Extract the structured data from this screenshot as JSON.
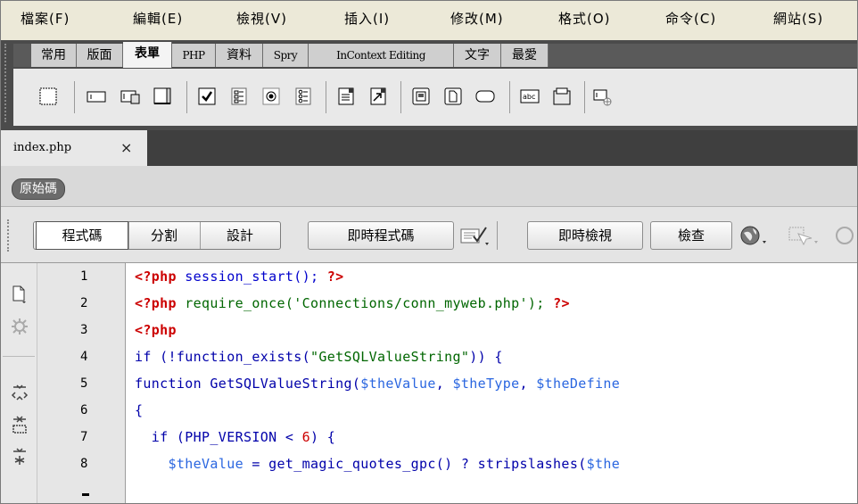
{
  "menubar": {
    "items": [
      "檔案(F)",
      "編輯(E)",
      "檢視(V)",
      "插入(I)",
      "修改(M)",
      "格式(O)",
      "命令(C)",
      "網站(S)"
    ]
  },
  "insert_panel": {
    "tabs": [
      "常用",
      "版面",
      "表單",
      "PHP",
      "資料",
      "Spry",
      "InContext Editing",
      "文字",
      "最愛"
    ],
    "active_tab": "表單",
    "icons": [
      "form-icon",
      "text-field-icon",
      "hidden-field-icon",
      "textarea-icon",
      "checkbox-icon",
      "checkbox-group-icon",
      "radio-button-icon",
      "radio-group-icon",
      "list-menu-icon",
      "jump-menu-icon",
      "image-field-icon",
      "file-field-icon",
      "button-icon",
      "label-icon",
      "fieldset-icon",
      "spry-validation-icon"
    ],
    "label_icon_text": "abc"
  },
  "document": {
    "tab_label": "index.php",
    "close_glyph": "×",
    "source_label": "原始碼"
  },
  "view_toolbar": {
    "code": "程式碼",
    "split": "分割",
    "design": "設計",
    "live_code": "即時程式碼",
    "live_view": "即時檢視",
    "inspect": "檢查"
  },
  "editor": {
    "line_numbers": [
      "1",
      "2",
      "3",
      "4",
      "5",
      "6",
      "7",
      "8"
    ],
    "lines": {
      "l1": {
        "a": "<?php",
        "b": " session_start(); ",
        "c": "?>"
      },
      "l2": {
        "a": "<?php",
        "b": " require_once(",
        "c": "'Connections/conn_myweb.php'",
        "d": "); ",
        "e": "?>"
      },
      "l3": {
        "a": "<?php"
      },
      "l4": {
        "a": "if (!function_exists(",
        "b": "\"GetSQLValueString\"",
        "c": ")) {"
      },
      "l5": {
        "a": "function GetSQLValueString(",
        "b": "$theValue",
        "c": ", ",
        "d": "$theType",
        "e": ", ",
        "f": "$theDefine"
      },
      "l6": {
        "a": "{"
      },
      "l7": {
        "a": "  if (PHP_VERSION < ",
        "b": "6",
        "c": ") {"
      },
      "l8": {
        "a": "    ",
        "b": "$theValue",
        "c": " = get_magic_quotes_gpc() ? stripslashes(",
        "d": "$the"
      }
    }
  },
  "colors": {
    "php_tag": "#cc0000",
    "function": "#0000cc",
    "string": "#006600",
    "variable": "#2a66e0"
  }
}
